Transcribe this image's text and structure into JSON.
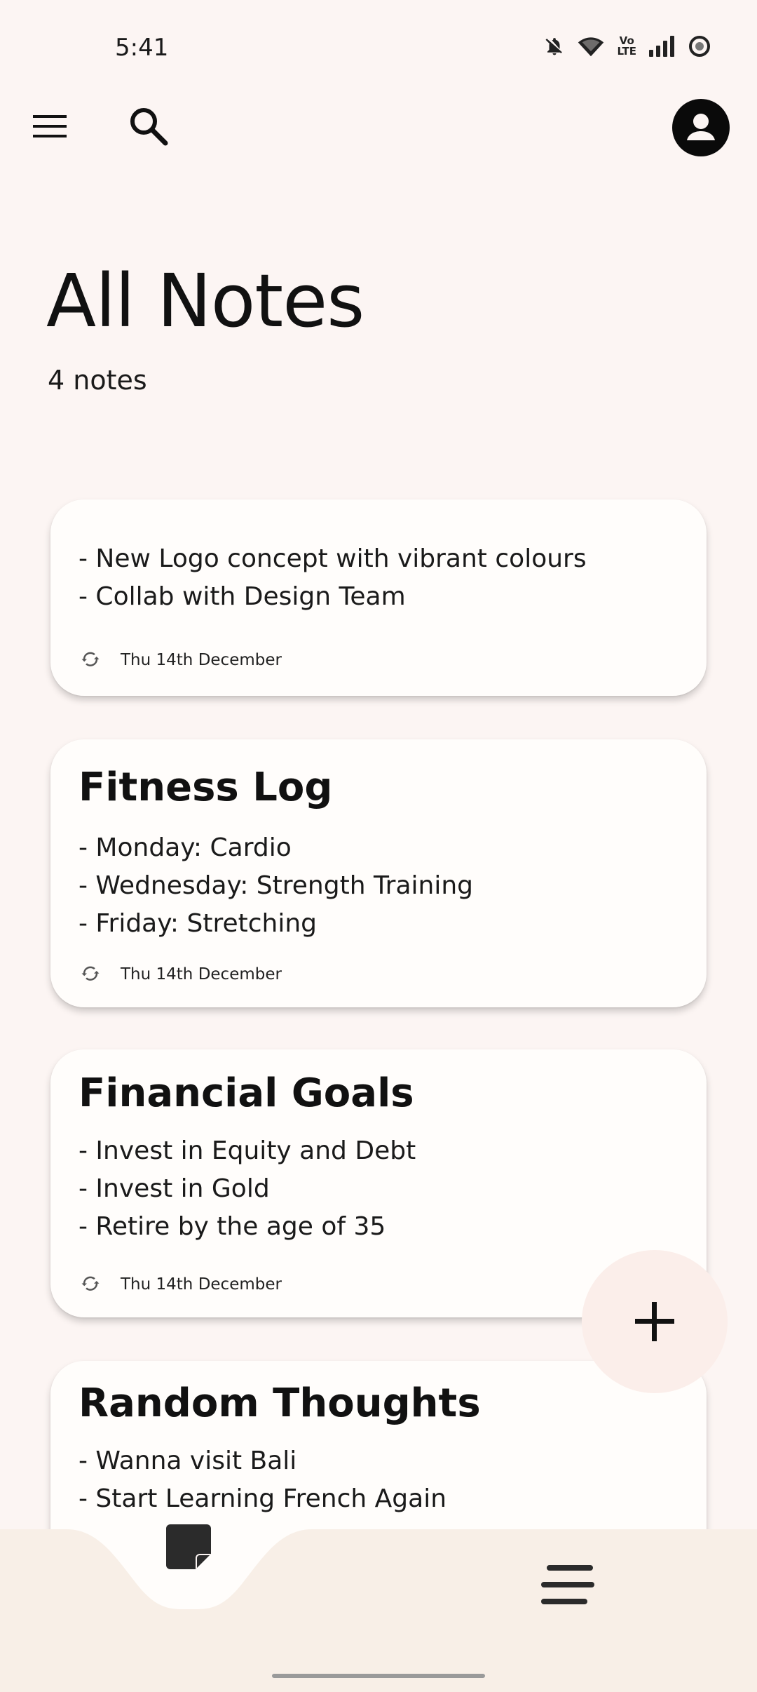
{
  "status_bar": {
    "time": "5:41",
    "icons": [
      "bell-off-icon",
      "wifi-icon",
      "volte-icon",
      "signal-icon",
      "battery-saver-icon"
    ],
    "volte_top": "Vo",
    "volte_bottom": "LTE"
  },
  "top_bar": {
    "menu_icon": "hamburger-menu-icon",
    "search_icon": "search-icon",
    "account_icon": "account-icon"
  },
  "header": {
    "title": "All Notes",
    "count": "4 notes"
  },
  "notes": [
    {
      "title": "",
      "lines": [
        "- New Logo concept with vibrant colours",
        "- Collab with Design Team"
      ],
      "date": "Thu 14th December"
    },
    {
      "title": "Fitness Log",
      "lines": [
        "- Monday: Cardio",
        "- Wednesday: Strength Training",
        "- Friday: Stretching"
      ],
      "date": "Thu 14th December"
    },
    {
      "title": "Financial Goals",
      "lines": [
        "- Invest in Equity and Debt",
        "- Invest in Gold",
        "- Retire by the age of 35"
      ],
      "date": "Thu 14th December"
    },
    {
      "title": "Random Thoughts",
      "lines": [
        "- Wanna visit Bali",
        "- Start Learning French Again"
      ],
      "date": ""
    }
  ],
  "fab": {
    "icon": "plus-icon"
  },
  "bottom_nav": {
    "items": [
      {
        "icon": "sticky-note-icon",
        "selected": true
      },
      {
        "icon": "menu-lines-icon",
        "selected": false
      }
    ]
  },
  "colors": {
    "background": "#fcf5f3",
    "card": "#fffdfb",
    "fab": "#fbeeea",
    "bottom_nav": "#f8efe7",
    "text": "#111111"
  }
}
